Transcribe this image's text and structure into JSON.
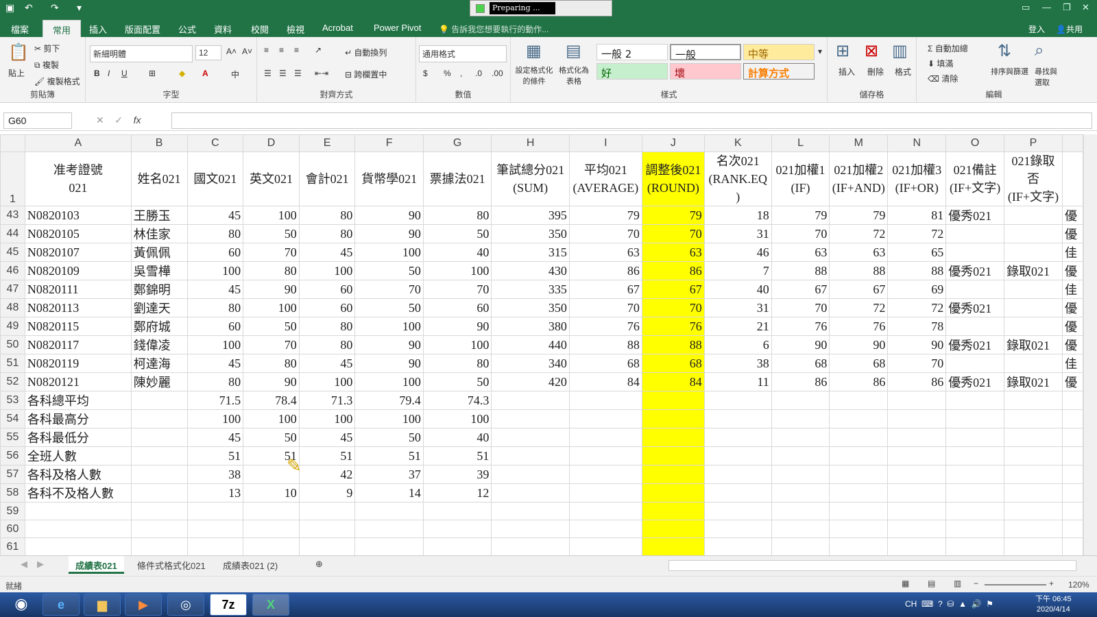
{
  "titlebar": {
    "progress": "Preparing ..."
  },
  "ribbon_tabs": [
    "檔案",
    "常用",
    "插入",
    "版面配置",
    "公式",
    "資料",
    "校閱",
    "檢視",
    "Acrobat",
    "Power Pivot"
  ],
  "tell_me": "告訴我您想要執行的動作...",
  "signin": "登入",
  "share": "共用",
  "clipboard": {
    "paste": "貼上",
    "cut": "剪下",
    "copy": "複製",
    "format_painter": "複製格式",
    "group": "剪貼簿"
  },
  "font": {
    "name": "新細明體",
    "size": "12",
    "group": "字型"
  },
  "alignment": {
    "wrap": "自動換列",
    "merge": "跨欄置中",
    "group": "對齊方式"
  },
  "number": {
    "format": "通用格式",
    "group": "數值"
  },
  "styles": {
    "conditional": "設定格式化的條件",
    "as_table": "格式化為表格",
    "normal2": "一般 2",
    "normal": "一般",
    "neutral": "中等",
    "good": "好",
    "bad": "壞",
    "calc": "計算方式",
    "group": "樣式"
  },
  "cells": {
    "insert": "插入",
    "delete": "刪除",
    "format": "格式",
    "group": "儲存格"
  },
  "editing": {
    "autosum": "自動加總",
    "fill": "填滿",
    "clear": "清除",
    "sort": "排序與篩選",
    "find": "尋找與選取",
    "group": "編輯"
  },
  "namebox": "G60",
  "columns": [
    "A",
    "B",
    "C",
    "D",
    "E",
    "F",
    "G",
    "H",
    "I",
    "J",
    "K",
    "L",
    "M",
    "N",
    "O",
    "P"
  ],
  "header_row": {
    "row": "1",
    "cells": [
      "准考證號\n021",
      "姓名021",
      "國文021",
      "英文021",
      "會計021",
      "貨幣學021",
      "票據法021",
      "筆試總分021\n(SUM)",
      "平均021\n(AVERAGE)",
      "調整後021\n(ROUND)",
      "名次021\n(RANK.EQ\n)",
      "021加權1\n(IF)",
      "021加權2\n(IF+AND)",
      "021加權3\n(IF+OR)",
      "021備註\n(IF+文字)",
      "021錄取\n否\n(IF+文字)"
    ]
  },
  "rows": [
    {
      "row": "43",
      "cells": [
        "N0820103",
        "王勝玉",
        "45",
        "100",
        "80",
        "90",
        "80",
        "395",
        "79",
        "79",
        "18",
        "79",
        "79",
        "81",
        "優秀021",
        "",
        "優"
      ]
    },
    {
      "row": "44",
      "cells": [
        "N0820105",
        "林佳家",
        "80",
        "50",
        "80",
        "90",
        "50",
        "350",
        "70",
        "70",
        "31",
        "70",
        "72",
        "72",
        "",
        "",
        "優"
      ]
    },
    {
      "row": "45",
      "cells": [
        "N0820107",
        "黃佩佩",
        "60",
        "70",
        "45",
        "100",
        "40",
        "315",
        "63",
        "63",
        "46",
        "63",
        "63",
        "65",
        "",
        "",
        "佳"
      ]
    },
    {
      "row": "46",
      "cells": [
        "N0820109",
        "吳雪樺",
        "100",
        "80",
        "100",
        "50",
        "100",
        "430",
        "86",
        "86",
        "7",
        "88",
        "88",
        "88",
        "優秀021",
        "錄取021",
        "優"
      ]
    },
    {
      "row": "47",
      "cells": [
        "N0820111",
        "鄭錦明",
        "45",
        "90",
        "60",
        "70",
        "70",
        "335",
        "67",
        "67",
        "40",
        "67",
        "67",
        "69",
        "",
        "",
        "佳"
      ]
    },
    {
      "row": "48",
      "cells": [
        "N0820113",
        "劉達天",
        "80",
        "100",
        "60",
        "50",
        "60",
        "350",
        "70",
        "70",
        "31",
        "70",
        "72",
        "72",
        "優秀021",
        "",
        "優"
      ]
    },
    {
      "row": "49",
      "cells": [
        "N0820115",
        "鄭府城",
        "60",
        "50",
        "80",
        "100",
        "90",
        "380",
        "76",
        "76",
        "21",
        "76",
        "76",
        "78",
        "",
        "",
        "優"
      ]
    },
    {
      "row": "50",
      "cells": [
        "N0820117",
        "錢偉凌",
        "100",
        "70",
        "80",
        "90",
        "100",
        "440",
        "88",
        "88",
        "6",
        "90",
        "90",
        "90",
        "優秀021",
        "錄取021",
        "優"
      ]
    },
    {
      "row": "51",
      "cells": [
        "N0820119",
        "柯達海",
        "45",
        "80",
        "45",
        "90",
        "80",
        "340",
        "68",
        "68",
        "38",
        "68",
        "68",
        "70",
        "",
        "",
        "佳"
      ]
    },
    {
      "row": "52",
      "cells": [
        "N0820121",
        "陳妙麗",
        "80",
        "90",
        "100",
        "100",
        "50",
        "420",
        "84",
        "84",
        "11",
        "86",
        "86",
        "86",
        "優秀021",
        "錄取021",
        "優"
      ]
    },
    {
      "row": "53",
      "cells": [
        "各科總平均",
        "",
        "71.5",
        "78.4",
        "71.3",
        "79.4",
        "74.3",
        "",
        "",
        "",
        "",
        "",
        "",
        "",
        "",
        "",
        ""
      ]
    },
    {
      "row": "54",
      "cells": [
        "各科最高分",
        "",
        "100",
        "100",
        "100",
        "100",
        "100",
        "",
        "",
        "",
        "",
        "",
        "",
        "",
        "",
        "",
        ""
      ]
    },
    {
      "row": "55",
      "cells": [
        "各科最低分",
        "",
        "45",
        "50",
        "45",
        "50",
        "40",
        "",
        "",
        "",
        "",
        "",
        "",
        "",
        "",
        "",
        ""
      ]
    },
    {
      "row": "56",
      "cells": [
        "全班人數",
        "",
        "51",
        "51",
        "51",
        "51",
        "51",
        "",
        "",
        "",
        "",
        "",
        "",
        "",
        "",
        "",
        ""
      ]
    },
    {
      "row": "57",
      "cells": [
        "各科及格人數",
        "",
        "38",
        "",
        "42",
        "37",
        "39",
        "",
        "",
        "",
        "",
        "",
        "",
        "",
        "",
        "",
        ""
      ]
    },
    {
      "row": "58",
      "cells": [
        "各科不及格人數",
        "",
        "13",
        "10",
        "9",
        "14",
        "12",
        "",
        "",
        "",
        "",
        "",
        "",
        "",
        "",
        "",
        ""
      ]
    },
    {
      "row": "59",
      "cells": [
        "",
        "",
        "",
        "",
        "",
        "",
        "",
        "",
        "",
        "",
        "",
        "",
        "",
        "",
        "",
        "",
        ""
      ]
    },
    {
      "row": "60",
      "cells": [
        "",
        "",
        "",
        "",
        "",
        "",
        "",
        "",
        "",
        "",
        "",
        "",
        "",
        "",
        "",
        "",
        ""
      ]
    },
    {
      "row": "61",
      "cells": [
        "",
        "",
        "",
        "",
        "",
        "",
        "",
        "",
        "",
        "",
        "",
        "",
        "",
        "",
        "",
        "",
        ""
      ]
    }
  ],
  "sheet_tabs": [
    "成績表021",
    "條件式格式化021",
    "成績表021 (2)"
  ],
  "status": "就緒",
  "zoom": "120%",
  "tray": {
    "lang": "CH",
    "time": "下午 06:45",
    "date": "2020/4/14"
  },
  "highlight_color": "#ffff00",
  "accent": "#217346"
}
